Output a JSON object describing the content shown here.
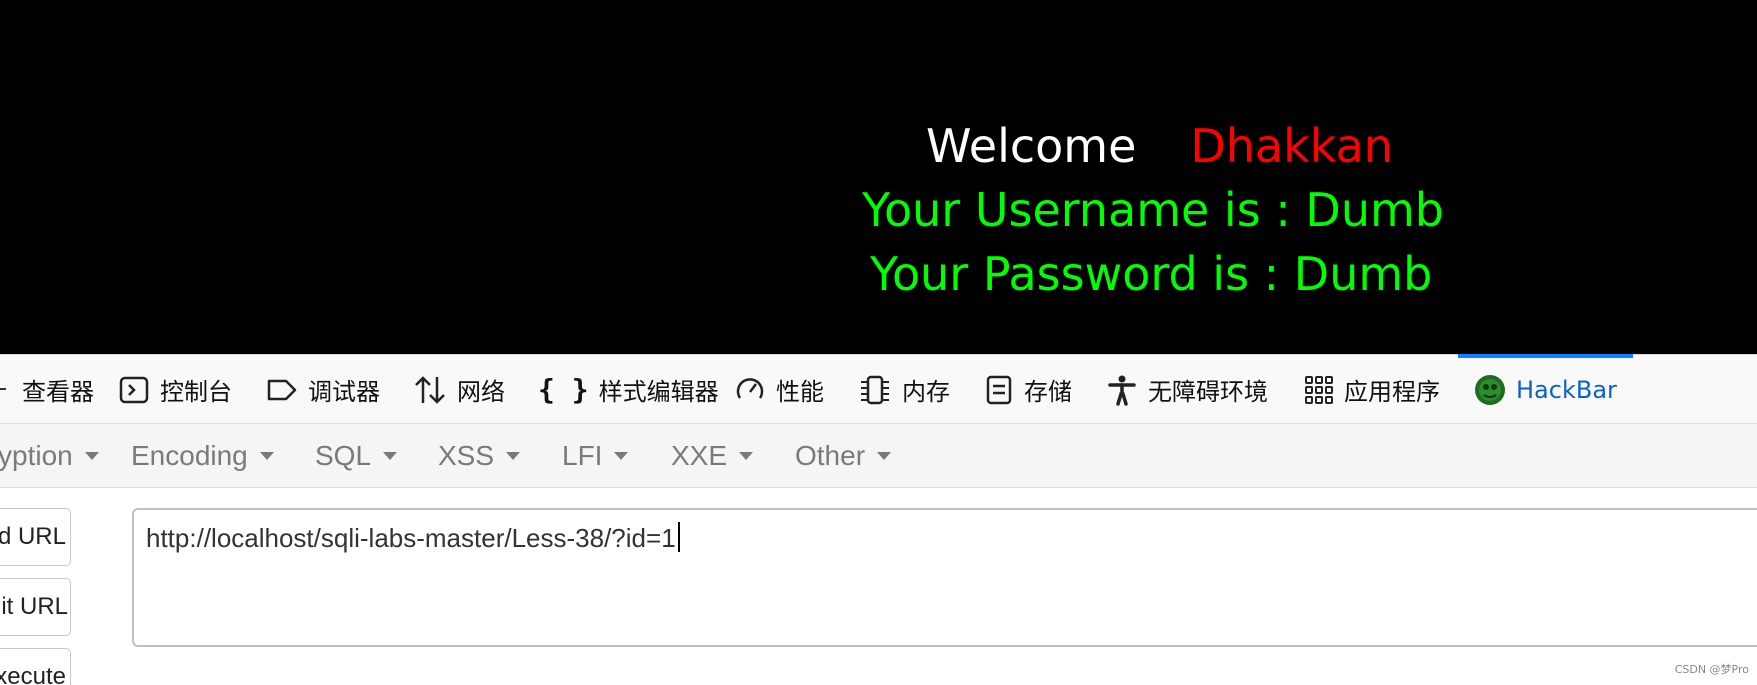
{
  "web_page": {
    "welcome": "Welcome",
    "user": "Dhakkan",
    "username_line": "Your Username is : Dumb",
    "password_line": "Your Password is : Dumb",
    "colors": {
      "background": "#000000",
      "welcome": "#ffffff",
      "user": "#ff0000",
      "info": "#00ff00"
    }
  },
  "devtools": {
    "tabs": [
      {
        "label": "查看器",
        "icon": "inspector-icon",
        "active": false
      },
      {
        "label": "控制台",
        "icon": "console-icon",
        "active": false
      },
      {
        "label": "调试器",
        "icon": "debugger-icon",
        "active": false
      },
      {
        "label": "网络",
        "icon": "network-arrows-icon",
        "active": false
      },
      {
        "label": "样式编辑器",
        "icon": "braces-icon",
        "active": false
      },
      {
        "label": "性能",
        "icon": "gauge-icon",
        "active": false
      },
      {
        "label": "内存",
        "icon": "memory-chip-icon",
        "active": false
      },
      {
        "label": "存储",
        "icon": "storage-icon",
        "active": false
      },
      {
        "label": "无障碍环境",
        "icon": "accessibility-icon",
        "active": false
      },
      {
        "label": "应用程序",
        "icon": "grid-icon",
        "active": false
      },
      {
        "label": "HackBar",
        "icon": "hackbar-logo-icon",
        "active": true
      }
    ],
    "active_color": "#0a84ff"
  },
  "hackbar": {
    "menus": [
      "yption",
      "Encoding",
      "SQL",
      "XSS",
      "LFI",
      "XXE",
      "Other"
    ],
    "buttons": {
      "load": "oad URL",
      "split": "plit URL",
      "execute": "xecute"
    },
    "url_value": "http://localhost/sqli-labs-master/Less-38/?id=1"
  },
  "watermark": "CSDN @梦Pro"
}
